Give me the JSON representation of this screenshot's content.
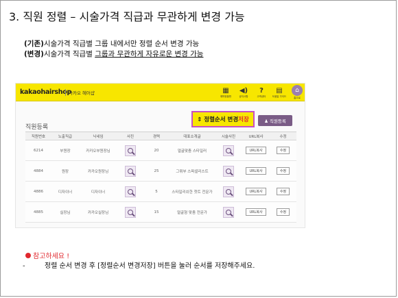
{
  "slide": {
    "title": "3. 직원 정렬 – 시술가격 직급과 무관하게 변경 가능",
    "line1_label": "(기존)",
    "line1_text": "시술가격 직급별 그룹 내에서만 정렬 순서 변경 가능",
    "line2_label": "(변경)",
    "line2_text_plain": "시술가격 직급별 ",
    "line2_text_underlined": "그룹과 무관하게 자유로운 변경 가능",
    "note_title": "참고하세요 !",
    "note_dash": "-",
    "note_text": "정렬 순서 변경 후 [정렬순서 변경저장] 버튼을 눌러 순서를 저장해주세요."
  },
  "app": {
    "brand": "kakaohairshop",
    "brand_sub": "카카오 헤어샵",
    "nav": [
      {
        "icon": "calendar-icon",
        "glyph": "▦",
        "label": "예약현황판"
      },
      {
        "icon": "speaker-icon",
        "glyph": "◀)",
        "label": "공지사항"
      },
      {
        "icon": "help-icon",
        "glyph": "?",
        "label": "고객센터"
      },
      {
        "icon": "guide-icon",
        "glyph": "▤",
        "label": "도움말 가이드"
      },
      {
        "icon": "home-icon",
        "glyph": "⌂",
        "label": "홈으로"
      }
    ],
    "section_title": "직원등록",
    "order_btn_prefix": "⇕ 정렬순서 변경",
    "order_btn_suffix": "저장",
    "reg_btn": "♟ 직원등록",
    "colors": {
      "accent_yellow": "#f7e600",
      "purple": "#7a5c86",
      "highlight": "#c84fc4",
      "red": "#e0282e"
    },
    "table": {
      "headers": [
        "직원번호",
        "노출직급",
        "닉네임",
        "사진",
        "경력",
        "대표소개글",
        "시술사진",
        "URL복사",
        "수정"
      ],
      "rows": [
        {
          "id": "6214",
          "rank": "부원장",
          "nick": "카카오부원장님",
          "career": "20",
          "intro": "얼굴맞춤 스타일러",
          "url": "URL복사",
          "edit": "수정"
        },
        {
          "id": "4884",
          "rank": "원장",
          "nick": "카카오원장님",
          "career": "25",
          "intro": "그뤼부 스퍼셜리스트",
          "url": "URL복사",
          "edit": "수정"
        },
        {
          "id": "4886",
          "rank": "디자이너",
          "nick": "디자이너",
          "career": "5",
          "intro": "스타일리쉬한 첫트 전문가",
          "url": "URL복사",
          "edit": "수정"
        },
        {
          "id": "4885",
          "rank": "실장님",
          "nick": "카카오실장님",
          "career": "15",
          "intro": "얼굴형 맞춤 전문가",
          "url": "URL복사",
          "edit": "수정"
        }
      ]
    }
  }
}
